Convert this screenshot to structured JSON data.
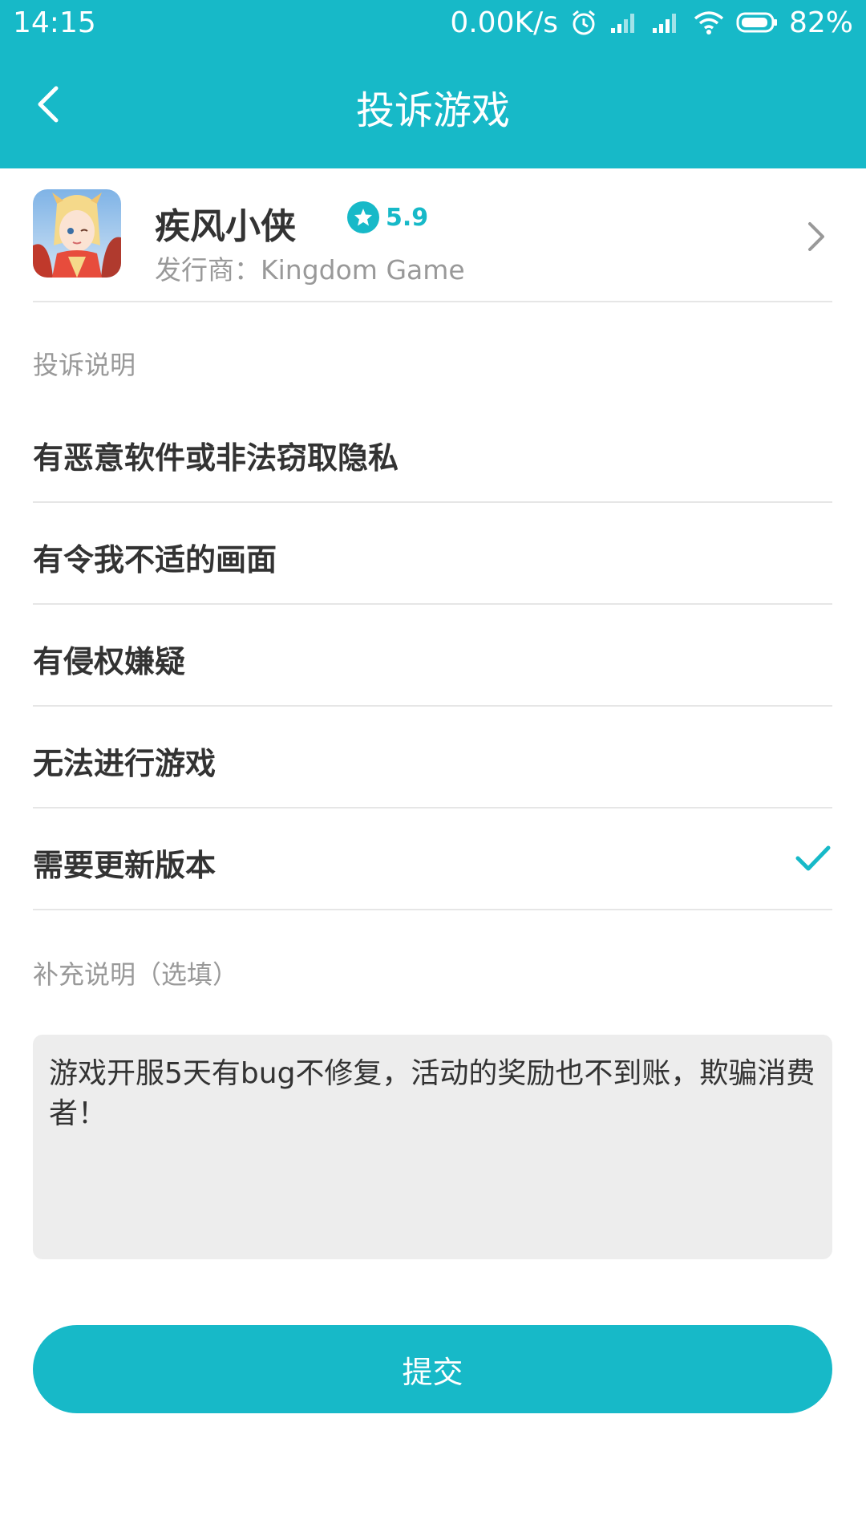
{
  "status_bar": {
    "time": "14:15",
    "net_speed": "0.00K/s",
    "battery": "82%"
  },
  "header": {
    "title": "投诉游戏"
  },
  "game": {
    "name": "疾风小侠",
    "rating": "5.9",
    "publisher": "发行商：Kingdom Game"
  },
  "complaint": {
    "section_label": "投诉说明",
    "options": [
      {
        "label": "有恶意软件或非法窃取隐私",
        "selected": false
      },
      {
        "label": "有令我不适的画面",
        "selected": false
      },
      {
        "label": "有侵权嫌疑",
        "selected": false
      },
      {
        "label": "无法进行游戏",
        "selected": false
      },
      {
        "label": "需要更新版本",
        "selected": true
      }
    ]
  },
  "supplement": {
    "label": "补充说明（选填）",
    "value": "游戏开服5天有bug不修复，活动的奖励也不到账，欺骗消费者！"
  },
  "submit_label": "提交",
  "colors": {
    "accent": "#17b9c8",
    "divider": "#e6e6e6",
    "textarea_bg": "#ededed"
  }
}
